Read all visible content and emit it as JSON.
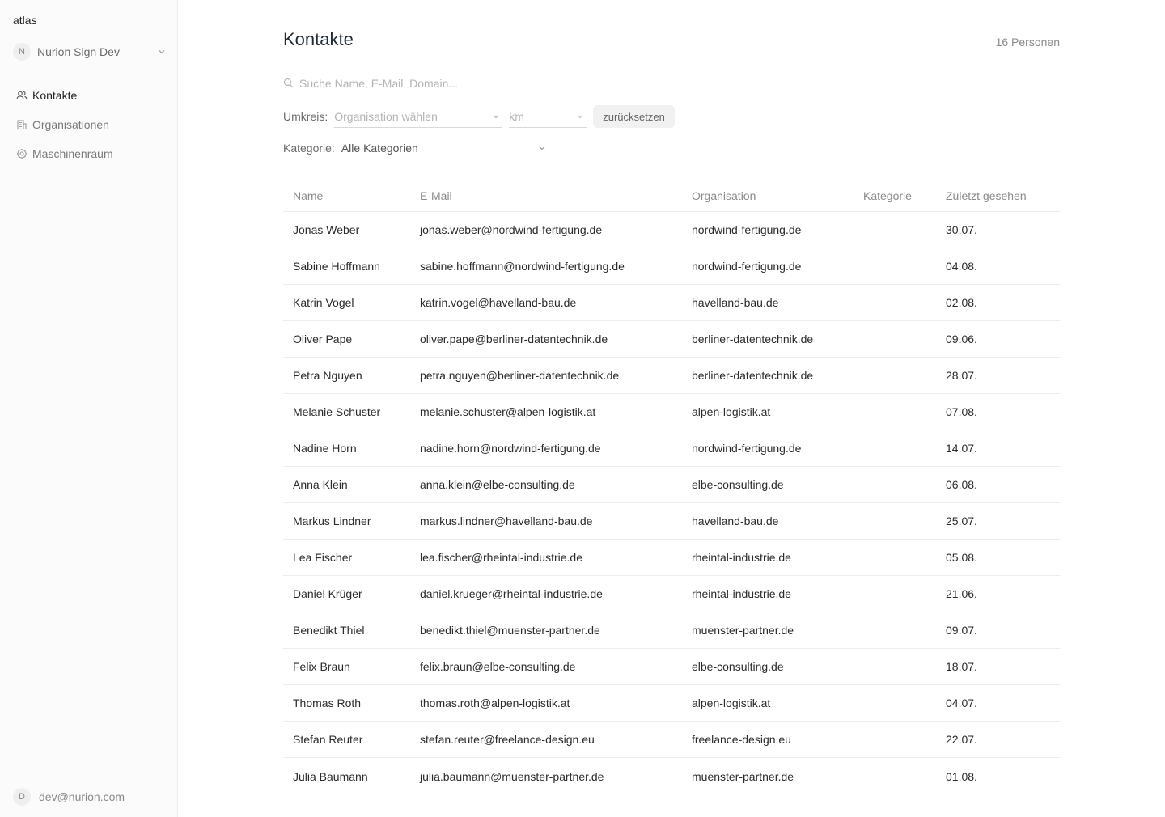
{
  "app": {
    "brand": "atlas"
  },
  "sidebar": {
    "org": {
      "initial": "N",
      "name": "Nurion Sign Dev"
    },
    "nav": [
      {
        "label": "Kontakte",
        "icon": "users-icon",
        "active": true
      },
      {
        "label": "Organisationen",
        "icon": "building-icon",
        "active": false
      },
      {
        "label": "Maschinenraum",
        "icon": "gear-icon",
        "active": false
      }
    ],
    "user": {
      "initial": "D",
      "email": "dev@nurion.com"
    }
  },
  "page": {
    "title": "Kontakte",
    "count": "16 Personen"
  },
  "search": {
    "placeholder": "Suche Name, E-Mail, Domain..."
  },
  "filters": {
    "radius_label": "Umkreis:",
    "org_placeholder": "Organisation wählen",
    "km_placeholder": "km",
    "reset_label": "zurücksetzen",
    "category_label": "Kategorie:",
    "category_value": "Alle Kategorien"
  },
  "table": {
    "headers": [
      "Name",
      "E-Mail",
      "Organisation",
      "Kategorie",
      "Zuletzt gesehen"
    ],
    "rows": [
      {
        "name": "Jonas Weber",
        "email": "jonas.weber@nordwind-fertigung.de",
        "org": "nordwind-fertigung.de",
        "category": "",
        "seen": "30.07."
      },
      {
        "name": "Sabine Hoffmann",
        "email": "sabine.hoffmann@nordwind-fertigung.de",
        "org": "nordwind-fertigung.de",
        "category": "",
        "seen": "04.08."
      },
      {
        "name": "Katrin Vogel",
        "email": "katrin.vogel@havelland-bau.de",
        "org": "havelland-bau.de",
        "category": "",
        "seen": "02.08."
      },
      {
        "name": "Oliver Pape",
        "email": "oliver.pape@berliner-datentechnik.de",
        "org": "berliner-datentechnik.de",
        "category": "",
        "seen": "09.06."
      },
      {
        "name": "Petra Nguyen",
        "email": "petra.nguyen@berliner-datentechnik.de",
        "org": "berliner-datentechnik.de",
        "category": "",
        "seen": "28.07."
      },
      {
        "name": "Melanie Schuster",
        "email": "melanie.schuster@alpen-logistik.at",
        "org": "alpen-logistik.at",
        "category": "",
        "seen": "07.08."
      },
      {
        "name": "Nadine Horn",
        "email": "nadine.horn@nordwind-fertigung.de",
        "org": "nordwind-fertigung.de",
        "category": "",
        "seen": "14.07."
      },
      {
        "name": "Anna Klein",
        "email": "anna.klein@elbe-consulting.de",
        "org": "elbe-consulting.de",
        "category": "",
        "seen": "06.08."
      },
      {
        "name": "Markus Lindner",
        "email": "markus.lindner@havelland-bau.de",
        "org": "havelland-bau.de",
        "category": "",
        "seen": "25.07."
      },
      {
        "name": "Lea Fischer",
        "email": "lea.fischer@rheintal-industrie.de",
        "org": "rheintal-industrie.de",
        "category": "",
        "seen": "05.08."
      },
      {
        "name": "Daniel Krüger",
        "email": "daniel.krueger@rheintal-industrie.de",
        "org": "rheintal-industrie.de",
        "category": "",
        "seen": "21.06."
      },
      {
        "name": "Benedikt Thiel",
        "email": "benedikt.thiel@muenster-partner.de",
        "org": "muenster-partner.de",
        "category": "",
        "seen": "09.07."
      },
      {
        "name": "Felix Braun",
        "email": "felix.braun@elbe-consulting.de",
        "org": "elbe-consulting.de",
        "category": "",
        "seen": "18.07."
      },
      {
        "name": "Thomas Roth",
        "email": "thomas.roth@alpen-logistik.at",
        "org": "alpen-logistik.at",
        "category": "",
        "seen": "04.07."
      },
      {
        "name": "Stefan Reuter",
        "email": "stefan.reuter@freelance-design.eu",
        "org": "freelance-design.eu",
        "category": "",
        "seen": "22.07."
      },
      {
        "name": "Julia Baumann",
        "email": "julia.baumann@muenster-partner.de",
        "org": "muenster-partner.de",
        "category": "",
        "seen": "01.08."
      }
    ]
  }
}
